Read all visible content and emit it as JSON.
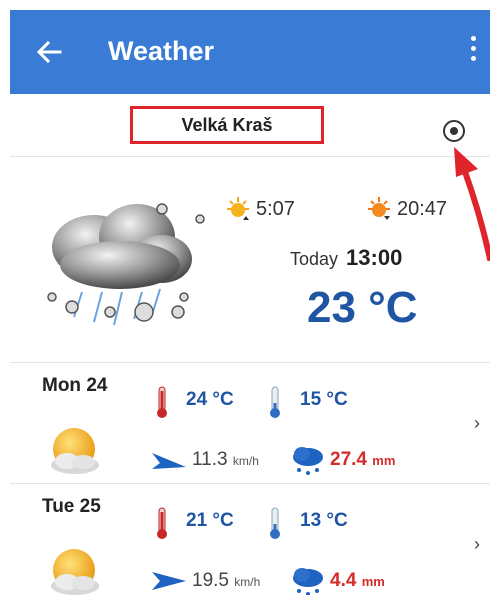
{
  "appbar": {
    "title": "Weather"
  },
  "location": {
    "name": "Velká Kraš"
  },
  "current": {
    "sunrise": "5:07",
    "sunset": "20:47",
    "day_label": "Today",
    "time": "13:00",
    "temperature": "23 °C"
  },
  "forecast": [
    {
      "day": "Mon 24",
      "high": "24 °C",
      "low": "15 °C",
      "wind_value": "11.3",
      "wind_unit": "km/h",
      "rain_value": "27.4",
      "rain_unit": "mm"
    },
    {
      "day": "Tue 25",
      "high": "21 °C",
      "low": "13 °C",
      "wind_value": "19.5",
      "wind_unit": "km/h",
      "rain_value": "4.4",
      "rain_unit": "mm"
    }
  ],
  "colors": {
    "appbar": "#3a7bd5",
    "temp_blue": "#1f55a3",
    "rain_red": "#d52b2b",
    "highlight": "#e0242b"
  },
  "icons": [
    "back-arrow-icon",
    "more-vert-icon",
    "gps-target-icon",
    "rain-cloud-icon",
    "sunrise-icon",
    "sunset-icon",
    "thermometer-hot-icon",
    "thermometer-cold-icon",
    "partly-cloudy-icon",
    "wind-direction-icon",
    "rain-icon",
    "chevron-right-icon"
  ]
}
